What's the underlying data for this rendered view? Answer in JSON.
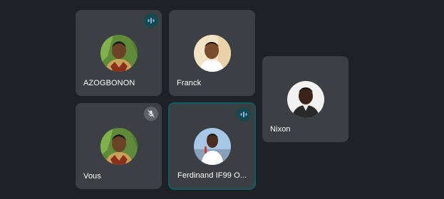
{
  "participants": [
    {
      "name": "AZOGBONON",
      "state": "speaking",
      "avatar": "man-portrait-avatar"
    },
    {
      "name": "Franck",
      "state": "none",
      "avatar": "man-portrait-avatar"
    },
    {
      "name": "Nixon",
      "state": "none",
      "avatar": "man-portrait-avatar"
    },
    {
      "name": "Vous",
      "state": "muted",
      "avatar": "man-portrait-avatar"
    },
    {
      "name": "Ferdinand IF99 O...",
      "state": "speaking",
      "avatar": "man-with-microphone-avatar"
    }
  ],
  "icons": {
    "speaking": "audio-level-icon",
    "muted": "mic-off-icon"
  },
  "colors": {
    "background": "#202124",
    "tile": "#3c4043",
    "active_border": "#0f5b63",
    "speaking_badge": "#154b50",
    "speaking_accent": "#8ab4f8",
    "muted_badge": "#5f6368"
  }
}
